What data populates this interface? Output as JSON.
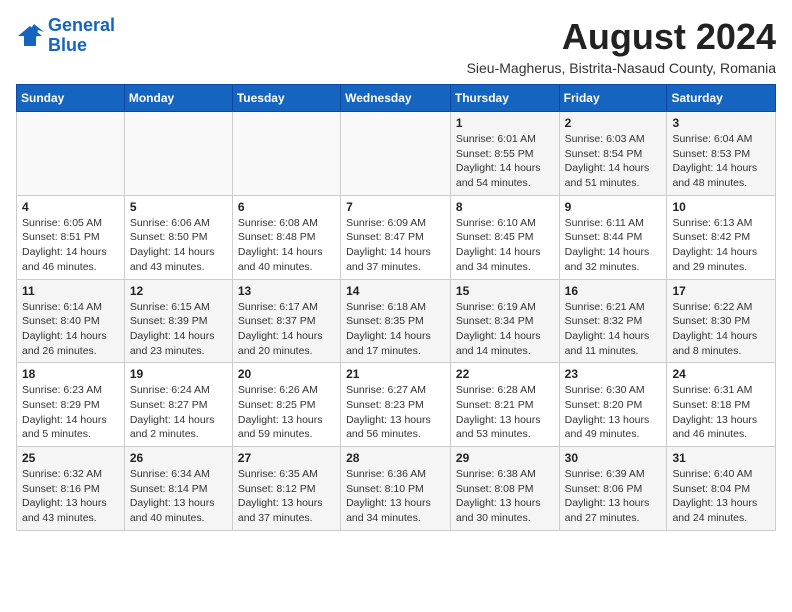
{
  "logo": {
    "line1": "General",
    "line2": "Blue"
  },
  "title": "August 2024",
  "location": "Sieu-Magherus, Bistrita-Nasaud County, Romania",
  "weekdays": [
    "Sunday",
    "Monday",
    "Tuesday",
    "Wednesday",
    "Thursday",
    "Friday",
    "Saturday"
  ],
  "weeks": [
    [
      {
        "day": "",
        "info": ""
      },
      {
        "day": "",
        "info": ""
      },
      {
        "day": "",
        "info": ""
      },
      {
        "day": "",
        "info": ""
      },
      {
        "day": "1",
        "info": "Sunrise: 6:01 AM\nSunset: 8:55 PM\nDaylight: 14 hours and 54 minutes."
      },
      {
        "day": "2",
        "info": "Sunrise: 6:03 AM\nSunset: 8:54 PM\nDaylight: 14 hours and 51 minutes."
      },
      {
        "day": "3",
        "info": "Sunrise: 6:04 AM\nSunset: 8:53 PM\nDaylight: 14 hours and 48 minutes."
      }
    ],
    [
      {
        "day": "4",
        "info": "Sunrise: 6:05 AM\nSunset: 8:51 PM\nDaylight: 14 hours and 46 minutes."
      },
      {
        "day": "5",
        "info": "Sunrise: 6:06 AM\nSunset: 8:50 PM\nDaylight: 14 hours and 43 minutes."
      },
      {
        "day": "6",
        "info": "Sunrise: 6:08 AM\nSunset: 8:48 PM\nDaylight: 14 hours and 40 minutes."
      },
      {
        "day": "7",
        "info": "Sunrise: 6:09 AM\nSunset: 8:47 PM\nDaylight: 14 hours and 37 minutes."
      },
      {
        "day": "8",
        "info": "Sunrise: 6:10 AM\nSunset: 8:45 PM\nDaylight: 14 hours and 34 minutes."
      },
      {
        "day": "9",
        "info": "Sunrise: 6:11 AM\nSunset: 8:44 PM\nDaylight: 14 hours and 32 minutes."
      },
      {
        "day": "10",
        "info": "Sunrise: 6:13 AM\nSunset: 8:42 PM\nDaylight: 14 hours and 29 minutes."
      }
    ],
    [
      {
        "day": "11",
        "info": "Sunrise: 6:14 AM\nSunset: 8:40 PM\nDaylight: 14 hours and 26 minutes."
      },
      {
        "day": "12",
        "info": "Sunrise: 6:15 AM\nSunset: 8:39 PM\nDaylight: 14 hours and 23 minutes."
      },
      {
        "day": "13",
        "info": "Sunrise: 6:17 AM\nSunset: 8:37 PM\nDaylight: 14 hours and 20 minutes."
      },
      {
        "day": "14",
        "info": "Sunrise: 6:18 AM\nSunset: 8:35 PM\nDaylight: 14 hours and 17 minutes."
      },
      {
        "day": "15",
        "info": "Sunrise: 6:19 AM\nSunset: 8:34 PM\nDaylight: 14 hours and 14 minutes."
      },
      {
        "day": "16",
        "info": "Sunrise: 6:21 AM\nSunset: 8:32 PM\nDaylight: 14 hours and 11 minutes."
      },
      {
        "day": "17",
        "info": "Sunrise: 6:22 AM\nSunset: 8:30 PM\nDaylight: 14 hours and 8 minutes."
      }
    ],
    [
      {
        "day": "18",
        "info": "Sunrise: 6:23 AM\nSunset: 8:29 PM\nDaylight: 14 hours and 5 minutes."
      },
      {
        "day": "19",
        "info": "Sunrise: 6:24 AM\nSunset: 8:27 PM\nDaylight: 14 hours and 2 minutes."
      },
      {
        "day": "20",
        "info": "Sunrise: 6:26 AM\nSunset: 8:25 PM\nDaylight: 13 hours and 59 minutes."
      },
      {
        "day": "21",
        "info": "Sunrise: 6:27 AM\nSunset: 8:23 PM\nDaylight: 13 hours and 56 minutes."
      },
      {
        "day": "22",
        "info": "Sunrise: 6:28 AM\nSunset: 8:21 PM\nDaylight: 13 hours and 53 minutes."
      },
      {
        "day": "23",
        "info": "Sunrise: 6:30 AM\nSunset: 8:20 PM\nDaylight: 13 hours and 49 minutes."
      },
      {
        "day": "24",
        "info": "Sunrise: 6:31 AM\nSunset: 8:18 PM\nDaylight: 13 hours and 46 minutes."
      }
    ],
    [
      {
        "day": "25",
        "info": "Sunrise: 6:32 AM\nSunset: 8:16 PM\nDaylight: 13 hours and 43 minutes."
      },
      {
        "day": "26",
        "info": "Sunrise: 6:34 AM\nSunset: 8:14 PM\nDaylight: 13 hours and 40 minutes."
      },
      {
        "day": "27",
        "info": "Sunrise: 6:35 AM\nSunset: 8:12 PM\nDaylight: 13 hours and 37 minutes."
      },
      {
        "day": "28",
        "info": "Sunrise: 6:36 AM\nSunset: 8:10 PM\nDaylight: 13 hours and 34 minutes."
      },
      {
        "day": "29",
        "info": "Sunrise: 6:38 AM\nSunset: 8:08 PM\nDaylight: 13 hours and 30 minutes."
      },
      {
        "day": "30",
        "info": "Sunrise: 6:39 AM\nSunset: 8:06 PM\nDaylight: 13 hours and 27 minutes."
      },
      {
        "day": "31",
        "info": "Sunrise: 6:40 AM\nSunset: 8:04 PM\nDaylight: 13 hours and 24 minutes."
      }
    ]
  ]
}
